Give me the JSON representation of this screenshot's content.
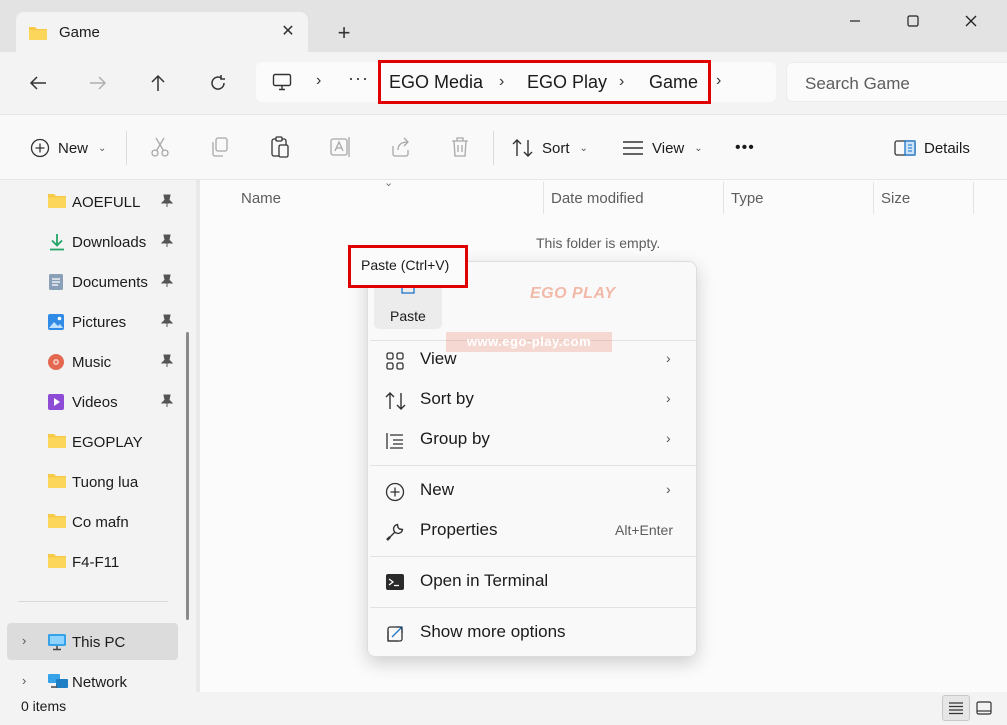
{
  "window": {
    "tab_title": "Game",
    "new_tab_icon": "plus-icon",
    "controls": [
      "minimize-icon",
      "maximize-icon",
      "close-icon"
    ]
  },
  "address": {
    "overflow": "···",
    "breadcrumbs": [
      "EGO Media",
      "EGO Play",
      "Game"
    ],
    "search_placeholder": "Search Game"
  },
  "toolbar": {
    "new_label": "New",
    "sort_label": "Sort",
    "view_label": "View",
    "more_label": "•••",
    "details_label": "Details"
  },
  "sidebar": {
    "quick_access": [
      {
        "label": "AOEFULL",
        "icon": "folder-icon",
        "pinned": true
      },
      {
        "label": "Downloads",
        "icon": "download-icon",
        "pinned": true
      },
      {
        "label": "Documents",
        "icon": "document-icon",
        "pinned": true
      },
      {
        "label": "Pictures",
        "icon": "picture-icon",
        "pinned": true
      },
      {
        "label": "Music",
        "icon": "music-icon",
        "pinned": true
      },
      {
        "label": "Videos",
        "icon": "video-icon",
        "pinned": true
      },
      {
        "label": "EGOPLAY",
        "icon": "folder-icon",
        "pinned": false
      },
      {
        "label": "Tuong lua",
        "icon": "folder-icon",
        "pinned": false
      },
      {
        "label": "Co mafn",
        "icon": "folder-icon",
        "pinned": false
      },
      {
        "label": "F4-F11",
        "icon": "folder-icon",
        "pinned": false
      }
    ],
    "this_pc": "This PC",
    "network": "Network"
  },
  "content": {
    "columns": [
      "Name",
      "Date modified",
      "Type",
      "Size"
    ],
    "empty_message": "This folder is empty."
  },
  "context_menu": {
    "paste_tooltip": "Paste (Ctrl+V)",
    "paste_label": "Paste",
    "items": [
      {
        "label": "View",
        "icon": "grid-icon",
        "submenu": true
      },
      {
        "label": "Sort by",
        "icon": "sort-icon",
        "submenu": true
      },
      {
        "label": "Group by",
        "icon": "group-icon",
        "submenu": true
      },
      {
        "label": "New",
        "icon": "add-circle-icon",
        "submenu": true
      },
      {
        "label": "Properties",
        "icon": "wrench-icon",
        "accelerator": "Alt+Enter"
      },
      {
        "label": "Open in Terminal",
        "icon": "terminal-icon"
      },
      {
        "label": "Show more options",
        "icon": "share-icon"
      }
    ]
  },
  "watermark": {
    "brand": "EGO PLAY",
    "url": "www.ego-play.com"
  },
  "status": {
    "item_count": "0 items"
  },
  "colors": {
    "highlight_box": "#e00000",
    "folder_yellow": "#f7c948",
    "accent_blue": "#1a73c9"
  }
}
